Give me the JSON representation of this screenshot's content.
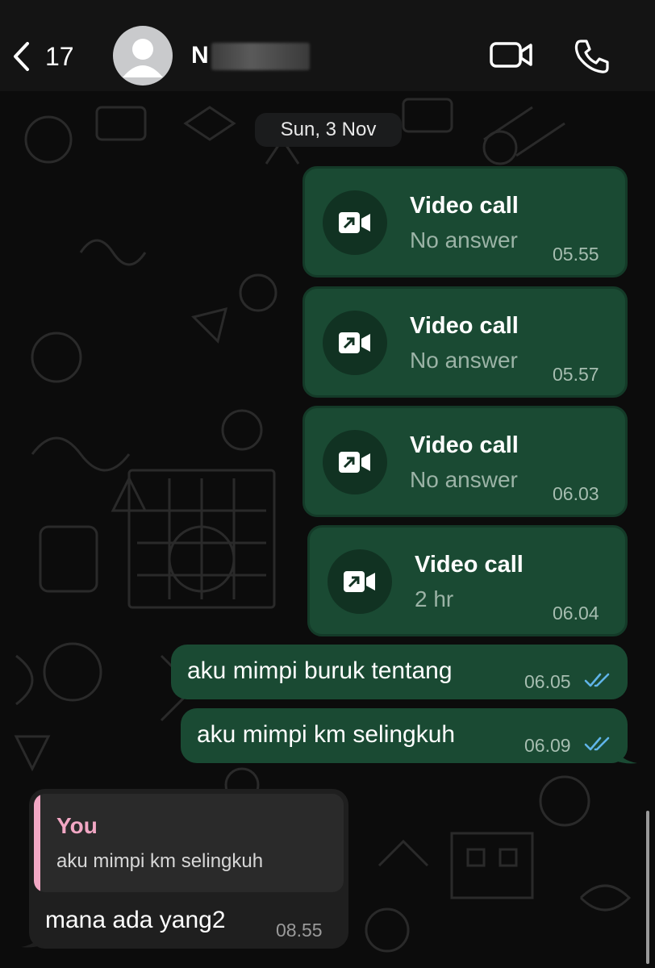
{
  "header": {
    "back_count": "17",
    "contact_name": "N"
  },
  "date_separator": "Sun, 3 Nov",
  "calls": [
    {
      "title": "Video call",
      "subtitle": "No answer",
      "time": "05.55"
    },
    {
      "title": "Video call",
      "subtitle": "No answer",
      "time": "05.57"
    },
    {
      "title": "Video call",
      "subtitle": "No answer",
      "time": "06.03"
    },
    {
      "title": "Video call",
      "subtitle": "2 hr",
      "time": "06.04"
    }
  ],
  "outgoing": [
    {
      "text": "aku mimpi buruk tentang",
      "time": "06.05",
      "status": "read"
    },
    {
      "text": "aku mimpi km selingkuh",
      "time": "06.09",
      "status": "read"
    }
  ],
  "incoming": {
    "quote_author": "You",
    "quote_text": "aku mimpi km selingkuh",
    "text": "mana ada yang2",
    "time": "08.55"
  },
  "colors": {
    "outgoing_bubble": "#1a4a33",
    "incoming_bubble": "#1f1f1f",
    "read_ticks": "#5fb4e8",
    "quote_accent": "#f2a7c4"
  }
}
